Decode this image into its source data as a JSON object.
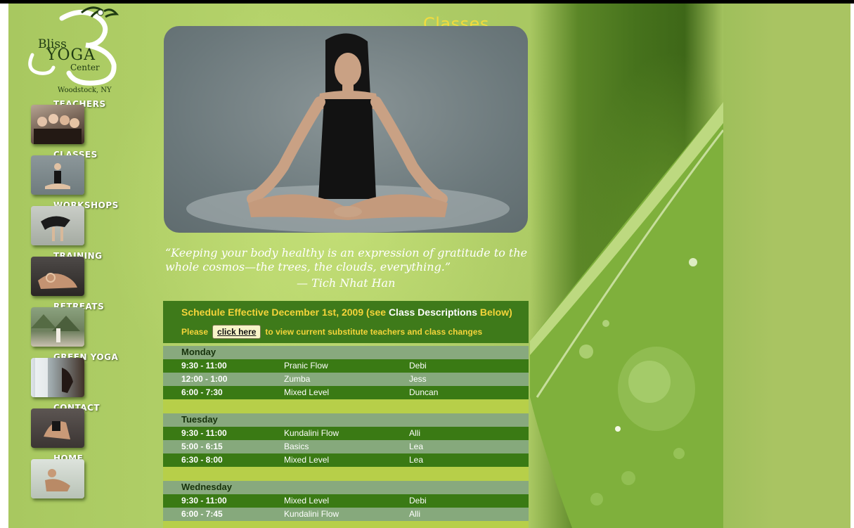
{
  "colors": {
    "page_bg": "#b4d26a",
    "title": "#f2dc3e",
    "schedule_header_bg": "#3e7a1a",
    "schedule_highlight": "#f4d43a",
    "row_dark": "#3a7a14",
    "row_light": "#86a97c",
    "day_header": "#88a97e",
    "spacer": "#b7cf49"
  },
  "logo": {
    "bliss": "Bliss",
    "yoga": "YOGA",
    "center": "Center",
    "location": "Woodstock, NY"
  },
  "nav": [
    {
      "label": "TEACHERS",
      "icon": "teachers-photo"
    },
    {
      "label": "CLASSES",
      "icon": "classes-photo"
    },
    {
      "label": "WORKSHOPS",
      "icon": "workshops-photo"
    },
    {
      "label": "TRAINING",
      "icon": "training-photo"
    },
    {
      "label": "RETREATS",
      "icon": "retreats-photo"
    },
    {
      "label": "GREEN YOGA",
      "icon": "green-yoga-photo"
    },
    {
      "label": "CONTACT",
      "icon": "contact-photo"
    },
    {
      "label": "HOME",
      "icon": "home-photo"
    }
  ],
  "page_title": "Classes",
  "quote": {
    "text": "“Keeping your body healthy is an expression of gratitude to the whole cosmos—the trees, the clouds, everything.”",
    "attribution": "— Tich Nhat Han"
  },
  "schedule": {
    "title_prefix": "Schedule Effective December 1st, 2009 (see ",
    "title_link": "Class Descriptions",
    "title_suffix": " Below)",
    "note_before": "Please",
    "button_label": "click here",
    "note_after": "to view current substitute teachers and class changes",
    "days": [
      {
        "name": "Monday",
        "classes": [
          {
            "time": "9:30 - 11:00",
            "class": "Pranic Flow",
            "teacher": "Debi"
          },
          {
            "time": "12:00 - 1:00",
            "class": "Zumba",
            "teacher": "Jess"
          },
          {
            "time": "6:00 - 7:30",
            "class": "Mixed Level",
            "teacher": "Duncan"
          }
        ]
      },
      {
        "name": "Tuesday",
        "classes": [
          {
            "time": "9:30 - 11:00",
            "class": "Kundalini Flow",
            "teacher": "Alli"
          },
          {
            "time": "5:00 - 6:15",
            "class": "Basics",
            "teacher": "Lea"
          },
          {
            "time": "6:30 - 8:00",
            "class": "Mixed Level",
            "teacher": "Lea"
          }
        ]
      },
      {
        "name": "Wednesday",
        "classes": [
          {
            "time": "9:30 - 11:00",
            "class": "Mixed Level",
            "teacher": "Debi"
          },
          {
            "time": "6:00 - 7:45",
            "class": "Kundalini Flow",
            "teacher": "Alli"
          }
        ]
      }
    ]
  }
}
